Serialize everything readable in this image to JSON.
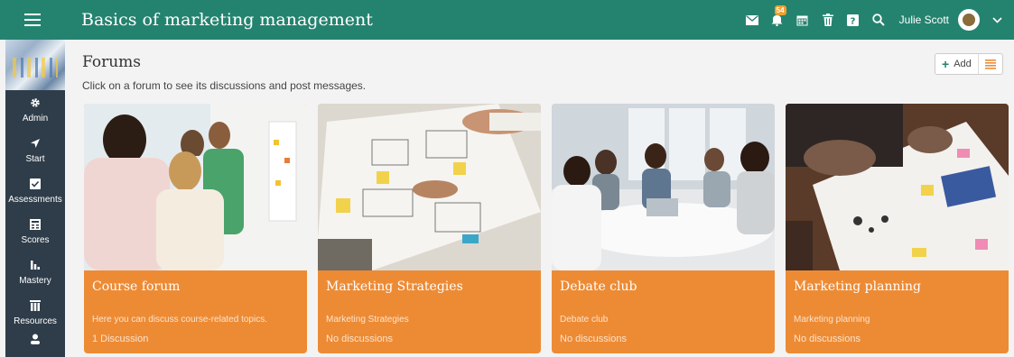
{
  "topbar": {
    "course_title": "Basics of marketing management",
    "notification_count": "54",
    "user_name": "Julie Scott",
    "color": "#24836f"
  },
  "sidebar": {
    "items": [
      {
        "label": "Admin",
        "icon": "gear-icon"
      },
      {
        "label": "Start",
        "icon": "arrow-icon"
      },
      {
        "label": "Assessments",
        "icon": "check-icon"
      },
      {
        "label": "Scores",
        "icon": "scores-icon"
      },
      {
        "label": "Mastery",
        "icon": "bar-chart-icon"
      },
      {
        "label": "Resources",
        "icon": "books-icon"
      }
    ]
  },
  "main": {
    "title": "Forums",
    "subtitle": "Click on a forum to see its discussions and post messages.",
    "add_label": "Add"
  },
  "forums": [
    {
      "name": "Course forum",
      "description": "Here you can discuss course-related topics.",
      "count": "1 Discussion"
    },
    {
      "name": "Marketing Strategies",
      "description": "Marketing Strategies",
      "count": "No discussions"
    },
    {
      "name": "Debate club",
      "description": "Debate club",
      "count": "No discussions"
    },
    {
      "name": "Marketing planning",
      "description": "Marketing planning",
      "count": "No discussions"
    }
  ],
  "card_color": "#ed8b35"
}
